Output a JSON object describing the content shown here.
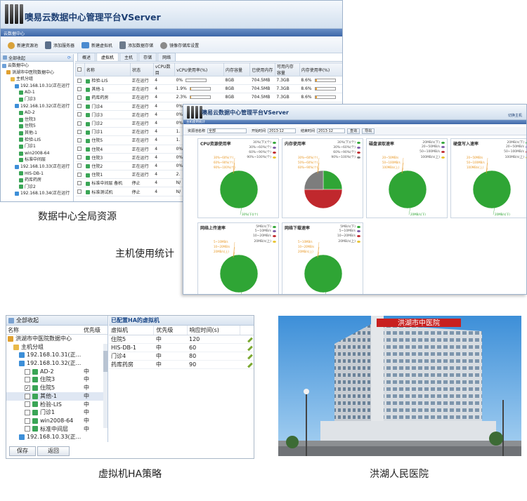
{
  "captions": {
    "dc_resources": "数据中心全局资源",
    "host_stats": "主机使用统计",
    "ha_policy": "虚拟机HA策略",
    "hospital": "洪湖人民医院"
  },
  "win1": {
    "title": "噢易云数据中心管理平台VServer",
    "subbar": "云数据中心",
    "toolbar": [
      "新建资源池",
      "添加服务器",
      "新建虚拟机",
      "添加数据存储",
      "镜像存储库设置"
    ],
    "tree_header": "全部收起",
    "tree": [
      {
        "label": "云数据中心",
        "level": 0,
        "kind": "cloud"
      },
      {
        "label": "洪湖市中医院数据中心",
        "level": 1,
        "kind": "dc"
      },
      {
        "label": "主机分组",
        "level": 2,
        "kind": "folder"
      },
      {
        "label": "192.168.10.31(正在运行",
        "level": 3,
        "kind": "host"
      },
      {
        "label": "AD-1",
        "level": 4,
        "kind": "vm"
      },
      {
        "label": "门诊3",
        "level": 4,
        "kind": "vm"
      },
      {
        "label": "192.168.10.32(正在运行",
        "level": 3,
        "kind": "host"
      },
      {
        "label": "AD-2",
        "level": 4,
        "kind": "vm"
      },
      {
        "label": "住院3",
        "level": 4,
        "kind": "vm"
      },
      {
        "label": "住院5",
        "level": 4,
        "kind": "vm"
      },
      {
        "label": "其他-1",
        "level": 4,
        "kind": "vm"
      },
      {
        "label": "检验-LIS",
        "level": 4,
        "kind": "vm"
      },
      {
        "label": "门诊1",
        "level": 4,
        "kind": "vm"
      },
      {
        "label": "win2008-64",
        "level": 4,
        "kind": "vm"
      },
      {
        "label": "标准中间层",
        "level": 4,
        "kind": "vm"
      },
      {
        "label": "192.168.10.33(正在运行",
        "level": 3,
        "kind": "host"
      },
      {
        "label": "HIS-DB-1",
        "level": 4,
        "kind": "vm"
      },
      {
        "label": "药库药房",
        "level": 4,
        "kind": "vm"
      },
      {
        "label": "门诊2",
        "level": 4,
        "kind": "vm"
      },
      {
        "label": "192.168.10.34(正在运行",
        "level": 3,
        "kind": "host"
      }
    ],
    "tabs": [
      "概述",
      "虚拟机",
      "主机",
      "存储",
      "网络"
    ],
    "active_tab": "虚拟机",
    "columns": [
      "名称",
      "状态",
      "vCPU数目",
      "vCPU使用率(%)",
      "内存容量",
      "已使用内存",
      "可用内存容量",
      "内存使用率(%)"
    ],
    "rows": [
      {
        "name": "检验-LIS",
        "status": "正在运行",
        "vcpu": "4",
        "cpu_pct": "0%",
        "cpu_fill": 0,
        "mem": "8GB",
        "used": "704.5MB",
        "free": "7.3GB",
        "mem_pct": "8.6%",
        "mem_fill": 0.086
      },
      {
        "name": "其他-1",
        "status": "正在运行",
        "vcpu": "4",
        "cpu_pct": "1.9%",
        "cpu_fill": 0.019,
        "mem": "8GB",
        "used": "704.5MB",
        "free": "7.3GB",
        "mem_pct": "8.6%",
        "mem_fill": 0.086
      },
      {
        "name": "药库药房",
        "status": "正在运行",
        "vcpu": "4",
        "cpu_pct": "2.3%",
        "cpu_fill": 0.023,
        "mem": "8GB",
        "used": "704.5MB",
        "free": "7.3GB",
        "mem_pct": "8.6%",
        "mem_fill": 0.086
      },
      {
        "name": "门诊4",
        "status": "正在运行",
        "vcpu": "4",
        "cpu_pct": "0%"
      },
      {
        "name": "门诊3",
        "status": "正在运行",
        "vcpu": "4",
        "cpu_pct": "0%"
      },
      {
        "name": "门诊2",
        "status": "正在运行",
        "vcpu": "4",
        "cpu_pct": "0%"
      },
      {
        "name": "门诊1",
        "status": "正在运行",
        "vcpu": "4",
        "cpu_pct": "1."
      },
      {
        "name": "住院5",
        "status": "正在运行",
        "vcpu": "4",
        "cpu_pct": "1."
      },
      {
        "name": "住院4",
        "status": "正在运行",
        "vcpu": "4",
        "cpu_pct": "0%"
      },
      {
        "name": "住院3",
        "status": "正在运行",
        "vcpu": "4",
        "cpu_pct": "0%"
      },
      {
        "name": "住院2",
        "status": "正在运行",
        "vcpu": "4",
        "cpu_pct": "0%"
      },
      {
        "name": "住院1",
        "status": "正在运行",
        "vcpu": "4",
        "cpu_pct": "2."
      },
      {
        "name": "标准中间层 备机",
        "status": "停止",
        "vcpu": "4",
        "cpu_pct": "N/"
      },
      {
        "name": "标准测试机",
        "status": "停止",
        "vcpu": "4",
        "cpu_pct": "N/"
      }
    ]
  },
  "win2": {
    "title": "噢易云数据中心管理平台VServer",
    "breadcrumb": "主机使用统计",
    "link": "切换主机",
    "filter": {
      "label1": "资源池名称",
      "value1": "全部",
      "label2": "开始时间",
      "value2": "2013-12",
      "label3": "结束时间",
      "value3": "2013-12",
      "query": "查询",
      "export": "导出"
    },
    "charts": [
      {
        "title": "CPU资源使用率",
        "legend": [
          "30%(下)(个)",
          "30%~60%(个)",
          "60%~90%(个)",
          "90%~100%(个)"
        ],
        "slices": [
          1.0,
          0,
          0,
          0
        ],
        "callouts": [
          "30%~60%(个)",
          "60%~90%(个)",
          "90%~100%(个)",
          "30%(下)(个)"
        ]
      },
      {
        "title": "内存使用率",
        "legend": [
          "30%(下)(个)",
          "30%~60%(个)",
          "60%~90%(个)",
          "90%~100%(个)"
        ],
        "slices": [
          0.25,
          0,
          0.5,
          0.25
        ],
        "callouts": [
          "30%~60%(个)",
          "50%~60%(个)",
          "60%~90%(个)"
        ]
      },
      {
        "title": "磁盘读取速率",
        "legend": [
          "20MB/s(下)",
          "20~50MB/s",
          "50~100MB/s",
          "100MB/s(上)"
        ],
        "slices": [
          1.0,
          0,
          0,
          0
        ],
        "callouts": [
          "20~50MB/s",
          "50~100MB/s",
          "100MB/s(上)",
          "20MB/s(下)"
        ]
      },
      {
        "title": "硬盘写入速率",
        "legend": [
          "20MB/s(下)",
          "20~50MB/s",
          "50~100MB/s",
          "100MB/s(上)"
        ],
        "slices": [
          1.0,
          0,
          0,
          0
        ],
        "callouts": [
          "20~50MB/s",
          "50~100MB/s",
          "100MB/s(上)",
          "20MB/s(下)"
        ]
      },
      {
        "title": "网络上传速率",
        "legend": [
          "5MB/s(下)",
          "5~10MB/s",
          "10~20MB/s",
          "20MB/s(上)"
        ],
        "slices": [
          1.0,
          0,
          0,
          0
        ],
        "callouts": [
          "5~10MB/s",
          "10~20MB/s",
          "20MB/s(上)",
          "5MB/s(下)"
        ]
      },
      {
        "title": "网络下载速率",
        "legend": [
          "5MB/s(下)",
          "5~10MB/s",
          "10~20MB/s",
          "20MB/s(上)"
        ],
        "slices": [
          1.0,
          0,
          0,
          0
        ],
        "callouts": [
          "5~10MB/s",
          "10~20MB/s",
          "20MB/s(上)",
          "5MB/s(下)"
        ]
      }
    ],
    "colors": {
      "green": "#2fa535",
      "red": "#c0282d",
      "purple": "#7c5aa6",
      "yellow": "#e8c431",
      "gray": "#7d7d7d"
    }
  },
  "win3": {
    "tree_header": "全部收起",
    "col_name": "名称",
    "col_priority": "优先级",
    "tree": [
      {
        "label": "洪湖市中医院数据中心",
        "level": 0,
        "kind": "dc",
        "pri": ""
      },
      {
        "label": "主机分组",
        "level": 1,
        "kind": "folder",
        "pri": ""
      },
      {
        "label": "192.168.10.31(正...",
        "level": 2,
        "kind": "host",
        "pri": ""
      },
      {
        "label": "192.168.10.32(正...",
        "level": 2,
        "kind": "host",
        "pri": ""
      },
      {
        "label": "AD-2",
        "level": 3,
        "kind": "vm",
        "pri": "中",
        "checked": false
      },
      {
        "label": "住院3",
        "level": 3,
        "kind": "vm",
        "pri": "中",
        "checked": false
      },
      {
        "label": "住院5",
        "level": 3,
        "kind": "vm",
        "pri": "中",
        "checked": true
      },
      {
        "label": "其他-1",
        "level": 3,
        "kind": "vm",
        "pri": "中",
        "checked": false,
        "selected": true
      },
      {
        "label": "检验-LIS",
        "level": 3,
        "kind": "vm",
        "pri": "中",
        "checked": false
      },
      {
        "label": "门诊1",
        "level": 3,
        "kind": "vm",
        "pri": "中",
        "checked": false
      },
      {
        "label": "win2008-64",
        "level": 3,
        "kind": "vm",
        "pri": "中",
        "checked": false
      },
      {
        "label": "标准中间层",
        "level": 3,
        "kind": "vm",
        "pri": "中",
        "checked": false
      },
      {
        "label": "192.168.10.33(正...",
        "level": 2,
        "kind": "host",
        "pri": ""
      }
    ],
    "right_header": "已配置HA的虚拟机",
    "right_cols": [
      "虚拟机",
      "优先级",
      "响应时间(s)"
    ],
    "right_rows": [
      {
        "vm": "住院5",
        "pri": "中",
        "time": "120"
      },
      {
        "vm": "HIS-DB-1",
        "pri": "中",
        "time": "60"
      },
      {
        "vm": "门诊4",
        "pri": "中",
        "time": "80"
      },
      {
        "vm": "药库药房",
        "pri": "中",
        "time": "90"
      }
    ],
    "save": "保存",
    "back": "返回"
  },
  "photo": {
    "sign": "洪湖市中医院"
  }
}
